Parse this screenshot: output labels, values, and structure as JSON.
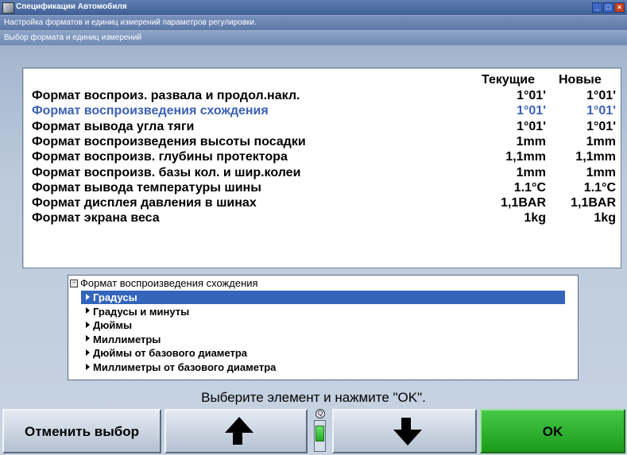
{
  "window": {
    "title": "Спецификации Автомобиля",
    "subtitle": "Настройка форматов и единиц измерений параметров регулировки.",
    "subsubtitle": "Выбор формата и единиц измерений"
  },
  "table": {
    "columns": {
      "current": "Текущие",
      "new": "Новые"
    },
    "rows": [
      {
        "label": "Формат воспроиз. развала и продол.накл.",
        "current": "1°01'",
        "new": "1°01'",
        "active": false
      },
      {
        "label": "Формат воспроизведения схождения",
        "current": "1°01'",
        "new": "1°01'",
        "active": true
      },
      {
        "label": "Формат вывода угла тяги",
        "current": "1°01'",
        "new": "1°01'",
        "active": false
      },
      {
        "label": "Формат воспроизведения высоты посадки",
        "current": "1mm",
        "new": "1mm",
        "active": false
      },
      {
        "label": "Формат воспроизв. глубины протектора",
        "current": "1,1mm",
        "new": "1,1mm",
        "active": false
      },
      {
        "label": "Формат воспроизв. базы кол. и шир.колеи",
        "current": "1mm",
        "new": "1mm",
        "active": false
      },
      {
        "label": "Формат вывода температуры шины",
        "current": "1.1°C",
        "new": "1.1°C",
        "active": false
      },
      {
        "label": "Формат дисплея давления в шинах",
        "current": "1,1BAR",
        "new": "1,1BAR",
        "active": false
      },
      {
        "label": "Формат экрана веса",
        "current": "1kg",
        "new": "1kg",
        "active": false
      }
    ]
  },
  "options": {
    "heading": "Формат воспроизведения схождения",
    "items": [
      {
        "label": "Градусы",
        "selected": true
      },
      {
        "label": "Градусы и минуты",
        "selected": false
      },
      {
        "label": "Дюймы",
        "selected": false
      },
      {
        "label": "Миллиметры",
        "selected": false
      },
      {
        "label": "Дюймы от базового диаметра",
        "selected": false
      },
      {
        "label": "Миллиметры от базового диаметра",
        "selected": false
      }
    ]
  },
  "instruction": "Выберите элемент и нажмите \"OK\".",
  "buttons": {
    "cancel": "Отменить выбор",
    "ok": "OK"
  },
  "icons": {
    "up": "arrow-up-icon",
    "down": "arrow-down-icon"
  },
  "scroll_position": 0.33
}
